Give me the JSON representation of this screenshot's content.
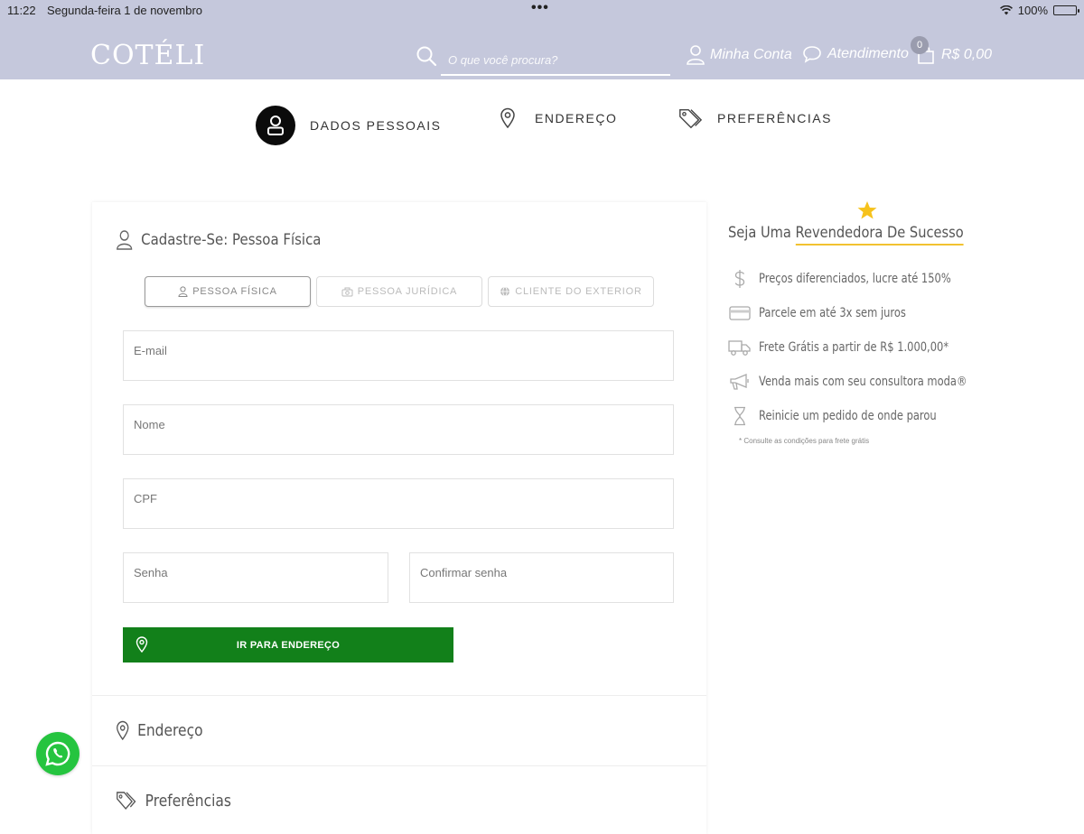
{
  "status_bar": {
    "time": "11:22",
    "date": "Segunda-feira 1 de novembro",
    "dots": "•••",
    "battery": "100%"
  },
  "header": {
    "logo": "COTÉLI",
    "search_placeholder": "O que você procura?",
    "account_label": "Minha Conta",
    "support_label": "Atendimento",
    "cart_count": "0",
    "cart_total": "R$ 0,00",
    "bg_color": "#c5c8dc"
  },
  "steps": [
    {
      "label": "DADOS PESSOAIS",
      "active": true
    },
    {
      "label": "ENDEREÇO",
      "active": false
    },
    {
      "label": "PREFERÊNCIAS",
      "active": false
    }
  ],
  "form": {
    "title": "Cadastre-Se: Pessoa Física",
    "type_tabs": [
      {
        "label": "PESSOA FÍSICA",
        "active": true
      },
      {
        "label": "PESSOA JURÍDICA",
        "active": false
      },
      {
        "label": "CLIENTE DO EXTERIOR",
        "active": false
      }
    ],
    "fields": {
      "email_placeholder": "E-mail",
      "nome_placeholder": "Nome",
      "cpf_placeholder": "CPF",
      "senha_placeholder": "Senha",
      "confirmar_placeholder": "Confirmar senha"
    },
    "submit_label": "IR PARA ENDEREÇO",
    "submit_color": "#12801a",
    "sections": {
      "endereco": "Endereço",
      "preferencias": "Preferências"
    }
  },
  "side": {
    "title_prefix": "Seja Uma ",
    "title_highlight": "Revendedora De Sucesso",
    "accent_color": "#f2c230",
    "benefits": [
      {
        "icon": "dollar-icon",
        "text": "Preços diferenciados, lucre até 150%"
      },
      {
        "icon": "credit-card-icon",
        "text": "Parcele em até 3x sem juros"
      },
      {
        "icon": "truck-icon",
        "text": "Frete Grátis a partir de R$ 1.000,00*"
      },
      {
        "icon": "megaphone-icon",
        "text": "Venda mais com seu consultora moda®"
      },
      {
        "icon": "hourglass-icon",
        "text": "Reinicie um pedido de onde parou"
      }
    ],
    "note": "* Consulte as condições para frete grátis"
  }
}
